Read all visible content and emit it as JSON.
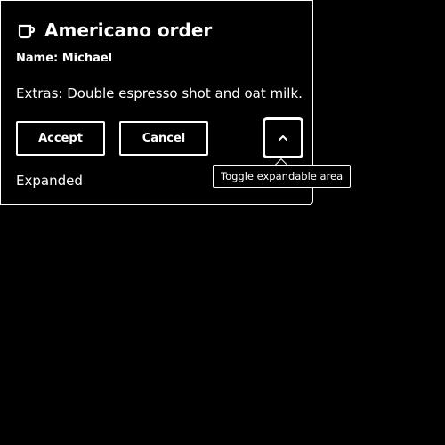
{
  "card": {
    "icon": "coffee-cup-icon",
    "title": "Americano order",
    "name_line": "Name: Michael",
    "extras_line": "Extras: Double espresso shot and oat milk.",
    "accept_label": "Accept",
    "cancel_label": "Cancel",
    "toggle_icon": "chevron-up-icon",
    "status_text": "Expanded"
  },
  "tooltip": {
    "text": "Toggle expandable area"
  },
  "colors": {
    "background": "#000000",
    "foreground": "#ffffff"
  }
}
